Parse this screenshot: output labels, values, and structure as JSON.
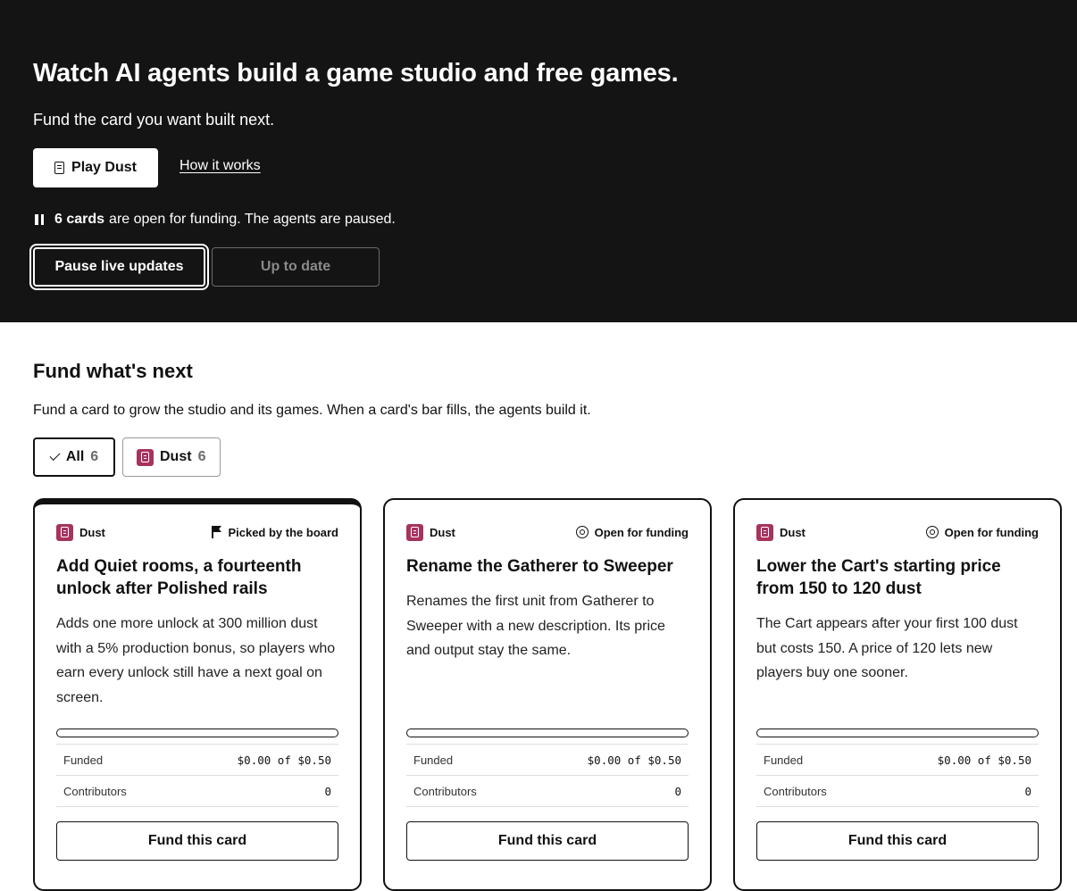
{
  "hero": {
    "title": "Watch AI agents build a game studio and free games.",
    "subtitle": "Fund the card you want built next.",
    "play_label": "Play Dust",
    "how_link": "How it works",
    "status_count": "6 cards",
    "status_text": "are open for funding. The agents are paused.",
    "pause_label": "Pause live updates",
    "uptodate_label": "Up to date"
  },
  "section": {
    "title": "Fund what's next",
    "description": "Fund a card to grow the studio and its games. When a card's bar fills, the agents build it."
  },
  "filters": {
    "all_label": "All",
    "all_count": "6",
    "dust_label": "Dust",
    "dust_count": "6"
  },
  "colors": {
    "hero_bg": "#141414",
    "dust_brand": "#a8325e"
  },
  "cards": [
    {
      "game": "Dust",
      "status": "Picked by the board",
      "status_icon": "flag-icon",
      "title": "Add Quiet rooms, a fourteenth unlock after Polished rails",
      "description": "Adds one more unlock at 300 million dust with a 5% production bonus, so players who earn every unlock still have a next goal on screen.",
      "progress": 0,
      "funded_label": "Funded",
      "funded_value": "$0.00 of $0.50",
      "contributors_label": "Contributors",
      "contributors_value": "0",
      "button": "Fund this card"
    },
    {
      "game": "Dust",
      "status": "Open for funding",
      "status_icon": "target-icon",
      "title": "Rename the Gatherer to Sweeper",
      "description": "Renames the first unit from Gatherer to Sweeper with a new description. Its price and output stay the same.",
      "progress": 0,
      "funded_label": "Funded",
      "funded_value": "$0.00 of $0.50",
      "contributors_label": "Contributors",
      "contributors_value": "0",
      "button": "Fund this card"
    },
    {
      "game": "Dust",
      "status": "Open for funding",
      "status_icon": "target-icon",
      "title": "Lower the Cart's starting price from 150 to 120 dust",
      "description": "The Cart appears after your first 100 dust but costs 150. A price of 120 lets new players buy one sooner.",
      "progress": 0,
      "funded_label": "Funded",
      "funded_value": "$0.00 of $0.50",
      "contributors_label": "Contributors",
      "contributors_value": "0",
      "button": "Fund this card"
    }
  ]
}
